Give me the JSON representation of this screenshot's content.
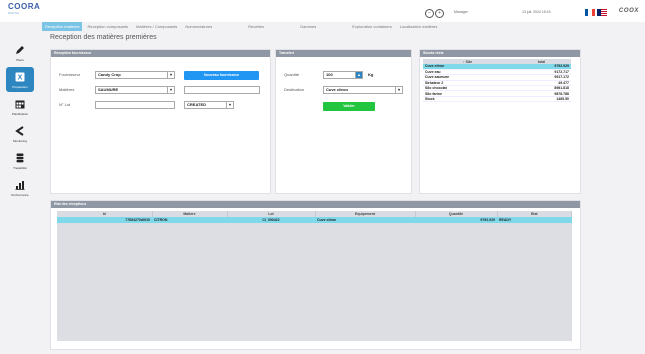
{
  "app": {
    "logo_text": "COORA",
    "logo_sub": "DIGITAL",
    "brand_right": "COOX",
    "user": "Manager",
    "datetime": "13 juil. 2024 15:15",
    "colors": {
      "accent": "#7bc4e6",
      "primary_button": "#2196f3",
      "validate_button": "#22c540",
      "panel_header": "#8e97a3",
      "highlight_row": "#7fd9ea"
    }
  },
  "tabs": [
    {
      "label": "Reception matieres",
      "active": true
    },
    {
      "label": "Reception composants",
      "active": false
    },
    {
      "label": "Matières / Composants",
      "active": false
    },
    {
      "label": "Nomenclatures",
      "active": false
    },
    {
      "label": "Recettes",
      "active": false
    },
    {
      "label": "Gammes",
      "active": false
    },
    {
      "label": "Exploration containers",
      "active": false
    },
    {
      "label": "Localisation matières",
      "active": false
    }
  ],
  "sidebar": {
    "items": [
      {
        "label": "Plans",
        "icon": "pencil-icon",
        "active": false
      },
      {
        "label": "Préparation",
        "icon": "excel-icon",
        "active": true
      },
      {
        "label": "Planification",
        "icon": "calendar-icon",
        "active": false
      },
      {
        "label": "Monitoring",
        "icon": "monitoring-icon",
        "active": false
      },
      {
        "label": "Traçabilité",
        "icon": "database-icon",
        "active": false
      },
      {
        "label": "Performance",
        "icon": "bar-chart-icon",
        "active": false
      }
    ]
  },
  "page": {
    "title": "Reception des matières premières"
  },
  "reception": {
    "header": "Réception fournisseur",
    "fournisseur_label": "Fournisseur",
    "fournisseur_value": "Candy Crop",
    "matiere_label": "Matières",
    "matiere_value": "SAUMURE",
    "lot_label": "N° Lot",
    "lot_value": "",
    "status_value": "CREATED",
    "new_supplier_button": "Nouveau fournisseur"
  },
  "transfert": {
    "header": "Transfert",
    "quantite_label": "Quantité",
    "quantite_value": "100",
    "unit": "Kg",
    "destination_label": "Destination",
    "destination_value": "Cuve citron",
    "validate_button": "Valider"
  },
  "stock": {
    "header": "Stocks réels",
    "columns": [
      "↑ Site",
      "total"
    ],
    "rows": [
      {
        "site": "Cuve citron",
        "total": "9792.929",
        "highlight": true
      },
      {
        "site": "Cuve eau",
        "total": "9172.717",
        "highlight": false
      },
      {
        "site": "Cuve saumure",
        "total": "9917.172",
        "highlight": false
      },
      {
        "site": "Sirbateur 2",
        "total": "49.477",
        "highlight": false
      },
      {
        "site": "Silo chocolat",
        "total": "8961.818",
        "highlight": false
      },
      {
        "site": "Silo farine",
        "total": "9878.788",
        "highlight": false
      },
      {
        "site": "Stock",
        "total": "1465.50",
        "highlight": false
      }
    ]
  },
  "receptions_table": {
    "header": "Etat des réceptions",
    "columns": [
      "Id",
      "Matiere",
      "Lot",
      "Equipement",
      "Quantité",
      "Etat"
    ],
    "rows": [
      {
        "id": "77854270d0f10",
        "matiere": "CITRON",
        "lot": "CI_090422",
        "equipement": "Cuve citron",
        "quantite": "9792.929",
        "etat": "READY"
      }
    ]
  }
}
